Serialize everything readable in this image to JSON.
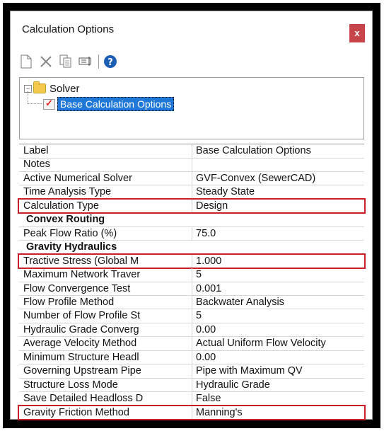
{
  "window": {
    "title": "Calculation Options",
    "close_glyph": "x"
  },
  "toolbar": [
    {
      "name": "new-icon",
      "glyph": "□"
    },
    {
      "name": "delete-icon",
      "glyph": "✕"
    },
    {
      "name": "copy-icon",
      "glyph": "⧉"
    },
    {
      "name": "rename-icon",
      "glyph": "▭"
    },
    {
      "name": "help-icon",
      "glyph": "?"
    }
  ],
  "tree": {
    "expander": "−",
    "root": "Solver",
    "child": "Base Calculation Options"
  },
  "properties": [
    {
      "key": "Label",
      "value": "Base Calculation Options"
    },
    {
      "key": "Notes",
      "value": ""
    },
    {
      "key": "Active Numerical Solver",
      "value": "GVF-Convex (SewerCAD)"
    },
    {
      "key": "Time Analysis Type",
      "value": "Steady State"
    },
    {
      "key": "Calculation Type",
      "value": "Design",
      "highlight": true
    },
    {
      "key": "Convex Routing",
      "value": "",
      "category": true
    },
    {
      "key": "Peak Flow Ratio (%)",
      "value": "75.0"
    },
    {
      "key": "Gravity Hydraulics",
      "value": "",
      "category": true
    },
    {
      "key": "Tractive Stress (Global M",
      "value": "1.000",
      "highlight": true
    },
    {
      "key": "Maximum Network Traver",
      "value": "5"
    },
    {
      "key": "Flow Convergence Test",
      "value": "0.001"
    },
    {
      "key": "Flow Profile Method",
      "value": "Backwater Analysis"
    },
    {
      "key": "Number of Flow Profile St",
      "value": "5"
    },
    {
      "key": "Hydraulic Grade Converg",
      "value": "0.00"
    },
    {
      "key": "Average Velocity Method",
      "value": "Actual Uniform Flow Velocity"
    },
    {
      "key": "Minimum Structure Headl",
      "value": "0.00"
    },
    {
      "key": "Governing Upstream Pipe",
      "value": "Pipe with Maximum QV"
    },
    {
      "key": "Structure Loss Mode",
      "value": "Hydraulic Grade"
    },
    {
      "key": "Save Detailed Headloss D",
      "value": "False"
    },
    {
      "key": "Gravity Friction Method",
      "value": "Manning's",
      "highlight": true
    }
  ],
  "colors": {
    "highlight": "#c8202b",
    "selection": "#1f77d8",
    "close": "#c7444a"
  }
}
